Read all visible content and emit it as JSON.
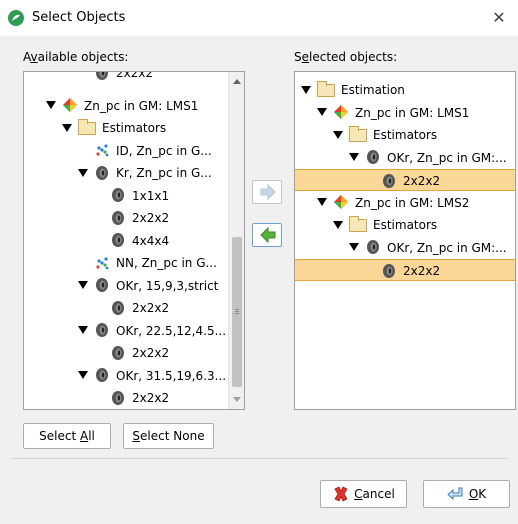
{
  "window": {
    "title": "Select Objects",
    "close_glyph": "✕"
  },
  "left_label": "Available objects:",
  "left_label_accel": "v",
  "right_label": "Selected objects:",
  "right_label_accel": "e",
  "left_tree": [
    {
      "text": "2x2x2",
      "icon": "volume-icon",
      "indent": 3,
      "expand": false,
      "partial": true
    },
    {
      "text": "Zn_pc in GM: LMS1",
      "icon": "model-icon",
      "indent": 1,
      "expand": true
    },
    {
      "text": "Estimators",
      "icon": "folder-icon",
      "indent": 2,
      "expand": true
    },
    {
      "text": "ID, Zn_pc in G...",
      "icon": "points-icon",
      "indent": 3,
      "expand": false
    },
    {
      "text": "Kr, Zn_pc in G...",
      "icon": "estimator-icon",
      "indent": 3,
      "expand": true
    },
    {
      "text": "1x1x1",
      "icon": "volume-icon",
      "indent": 4,
      "expand": false
    },
    {
      "text": "2x2x2",
      "icon": "volume-icon",
      "indent": 4,
      "expand": false
    },
    {
      "text": "4x4x4",
      "icon": "volume-icon",
      "indent": 4,
      "expand": false
    },
    {
      "text": "NN, Zn_pc in G...",
      "icon": "points-icon",
      "indent": 3,
      "expand": false
    },
    {
      "text": "OKr, 15,9,3,strict",
      "icon": "estimator-icon",
      "indent": 3,
      "expand": true
    },
    {
      "text": "2x2x2",
      "icon": "volume-icon",
      "indent": 4,
      "expand": false
    },
    {
      "text": "OKr, 22.5,12,4.5...",
      "icon": "estimator-icon",
      "indent": 3,
      "expand": true
    },
    {
      "text": "2x2x2",
      "icon": "volume-icon",
      "indent": 4,
      "expand": false
    },
    {
      "text": "OKr, 31.5,19,6.3...",
      "icon": "estimator-icon",
      "indent": 3,
      "expand": true
    },
    {
      "text": "2x2x2",
      "icon": "volume-icon",
      "indent": 4,
      "expand": false
    }
  ],
  "right_tree": [
    {
      "text": "Estimation",
      "icon": "folder-icon",
      "indent": 0,
      "expand": true,
      "selected": false
    },
    {
      "text": "Zn_pc in GM: LMS1",
      "icon": "model-icon",
      "indent": 1,
      "expand": true,
      "selected": false
    },
    {
      "text": "Estimators",
      "icon": "folder-icon",
      "indent": 2,
      "expand": true,
      "selected": false
    },
    {
      "text": "OKr, Zn_pc in GM:...",
      "icon": "estimator-icon",
      "indent": 3,
      "expand": true,
      "selected": false
    },
    {
      "text": "2x2x2",
      "icon": "volume-icon",
      "indent": 4,
      "expand": false,
      "selected": true
    },
    {
      "text": "Zn_pc in GM: LMS2",
      "icon": "model-icon",
      "indent": 1,
      "expand": true,
      "selected": false
    },
    {
      "text": "Estimators",
      "icon": "folder-icon",
      "indent": 2,
      "expand": true,
      "selected": false
    },
    {
      "text": "OKr, Zn_pc in GM:...",
      "icon": "estimator-icon",
      "indent": 3,
      "expand": true,
      "selected": false
    },
    {
      "text": "2x2x2",
      "icon": "volume-icon",
      "indent": 4,
      "expand": false,
      "selected": true
    }
  ],
  "buttons": {
    "select_all": "Select All",
    "select_all_accel": "A",
    "select_none": "Select None",
    "select_none_accel": "S",
    "cancel": "Cancel",
    "cancel_accel": "C",
    "ok": "OK",
    "ok_accel": "O"
  },
  "colors": {
    "selection_bg": "#fbd797",
    "selection_border": "#e8a33a",
    "move_left_arrow": "#58b038",
    "move_right_arrow_disabled": "#c8d8e8"
  }
}
